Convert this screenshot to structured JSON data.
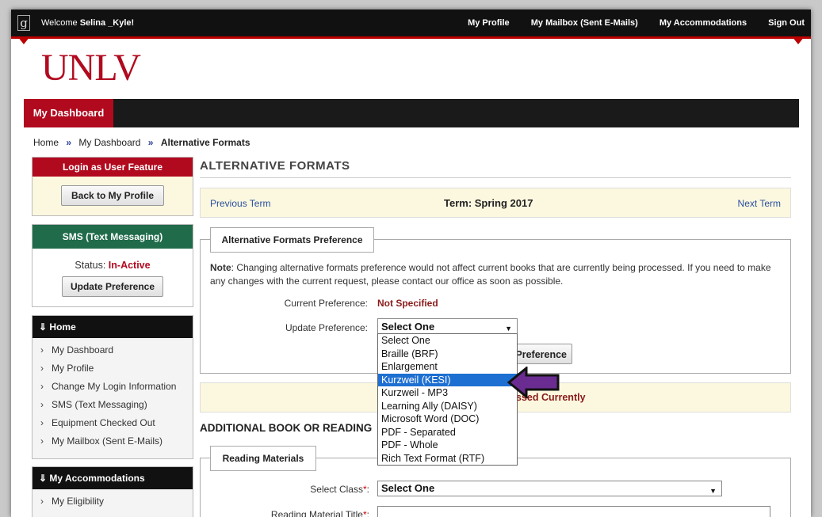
{
  "topbar": {
    "logo_glyph": "g",
    "welcome_prefix": "Welcome",
    "user_name": "Selina _Kyle!",
    "nav": [
      "My Profile",
      "My Mailbox (Sent E-Mails)",
      "My Accommodations",
      "Sign Out"
    ]
  },
  "brand": {
    "logo_text": "UNLV",
    "color": "#b10a1f"
  },
  "navbar": {
    "active_tab": "My Dashboard"
  },
  "breadcrumb": {
    "home": "Home",
    "dashboard": "My Dashboard",
    "current": "Alternative Formats",
    "sep": "»"
  },
  "sidebar": {
    "login_feature": {
      "title": "Login as User Feature",
      "button": "Back to My Profile"
    },
    "sms": {
      "title": "SMS (Text Messaging)",
      "status_label": "Status:",
      "status_value": "In-Active",
      "button": "Update Preference"
    },
    "home_nav": {
      "title": "Home",
      "items": [
        "My Dashboard",
        "My Profile",
        "Change My Login Information",
        "SMS (Text Messaging)",
        "Equipment Checked Out",
        "My Mailbox (Sent E-Mails)"
      ]
    },
    "accommodations_nav": {
      "title": "My Accommodations",
      "items": [
        "My Eligibility"
      ]
    }
  },
  "main": {
    "title": "ALTERNATIVE FORMATS",
    "term": {
      "prev": "Previous Term",
      "current": "Term: Spring 2017",
      "next": "Next Term"
    },
    "preference": {
      "legend": "Alternative Formats Preference",
      "note_label": "Note",
      "note_text": ": Changing alternative formats preference would not affect current books that are currently being processed. If you need to make any changes with the current request, please contact our office as soon as possible.",
      "current_label": "Current Preference:",
      "current_value": "Not Specified",
      "update_label": "Update Preference:",
      "select_value": "Select One",
      "options": [
        "Select One",
        "Braille (BRF)",
        "Enlargement",
        "Kurzweil (KESI)",
        "Kurzweil - MP3",
        "Learning Ally (DAISY)",
        "Microsoft Word (DOC)",
        "PDF - Separated",
        "PDF - Whole",
        "Rich Text Format (RTF)"
      ],
      "highlighted_option": "Kurzweil (KESI)",
      "button_visible": "Preference"
    },
    "info_visible": "ssed Currently",
    "additional_title": "ADDITIONAL BOOK OR READING",
    "reading": {
      "legend": "Reading Materials",
      "class_label": "Select Class",
      "class_value": "Select One",
      "title_label": "Reading Material Title"
    }
  },
  "colors": {
    "accent_red": "#b10a1f",
    "sms_green": "#1f6b4a",
    "link_blue": "#2a4fa0",
    "highlight": "#1e6fd2",
    "arrow_purple": "#6a2c91"
  }
}
